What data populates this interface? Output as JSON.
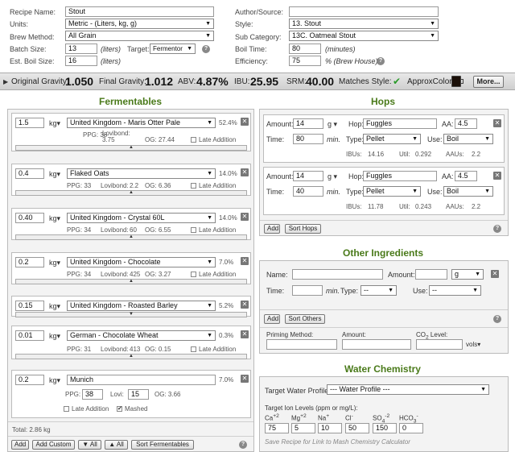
{
  "recipe": {
    "name_label": "Recipe Name:",
    "name_value": "Stout",
    "units_label": "Units:",
    "units_value": "Metric - (Liters, kg, g)",
    "method_label": "Brew Method:",
    "method_value": "All Grain",
    "batch_label": "Batch Size:",
    "batch_value": "13",
    "batch_unit": "(liters)",
    "target_label": "Target:",
    "target_value": "Fermentor",
    "boil_size_label": "Est. Boil Size:",
    "boil_size_value": "16",
    "boil_size_unit": "(liters)",
    "author_label": "Author/Source:",
    "author_value": "",
    "style_label": "Style:",
    "style_value": "13. Stout",
    "subcat_label": "Sub Category:",
    "subcat_value": "13C. Oatmeal Stout",
    "boil_time_label": "Boil Time:",
    "boil_time_value": "80",
    "boil_time_unit": "(minutes)",
    "eff_label": "Efficiency:",
    "eff_value": "75",
    "eff_unit": "% (Brew House)"
  },
  "stats": {
    "og_label": "Original Gravity:",
    "og_value": "1.050",
    "fg_label": "Final Gravity:",
    "fg_value": "1.012",
    "abv_label": "ABV:",
    "abv_value": "4.87%",
    "ibu_label": "IBU:",
    "ibu_value": "25.95",
    "srm_label": "SRM:",
    "srm_value": "40.00",
    "matches_label": "Matches Style:",
    "color_label": "ApproxColor:",
    "more_button": "More...",
    "check_icon": "✔"
  },
  "fermentables": {
    "title": "Fermentables",
    "kg_unit": "kg▾",
    "late_label": "Late Addition",
    "mashed_label": "Mashed",
    "items": [
      {
        "amount": "1.5",
        "name": "United Kingdom - Maris Otter Pale",
        "pct": "52.4%",
        "ppg": "PPG: 38",
        "lov_label": "Lovibond:",
        "lov": "3.75",
        "og": "OG: 27.44"
      },
      {
        "amount": "0.4",
        "name": "Flaked Oats",
        "pct": "14.0%",
        "ppg": "PPG: 33",
        "lov_label": "Lovibond:",
        "lov": "2.2",
        "og": "OG: 6.36"
      },
      {
        "amount": "0.40",
        "name": "United Kingdom - Crystal 60L",
        "pct": "14.0%",
        "ppg": "PPG: 34",
        "lov_label": "Lovibond:",
        "lov": "60",
        "og": "OG: 6.55"
      },
      {
        "amount": "0.2",
        "name": "United Kingdom - Chocolate",
        "pct": "7.0%",
        "ppg": "PPG: 34",
        "lov_label": "Lovibond:",
        "lov": "425",
        "og": "OG: 3.27"
      },
      {
        "amount": "0.15",
        "name": "United Kingdom - Roasted Barley",
        "pct": "5.2%",
        "ppg": "",
        "lov_label": "",
        "lov": "",
        "og": ""
      },
      {
        "amount": "0.01",
        "name": "German - Chocolate Wheat",
        "pct": "0.3%",
        "ppg": "PPG: 31",
        "lov_label": "Lovibond:",
        "lov": "413",
        "og": "OG: 0.15"
      }
    ],
    "custom": {
      "amount": "0.2",
      "name": "Munich",
      "pct": "7.0%",
      "ppg_label": "PPG:",
      "ppg": "38",
      "lovi_label": "Lovi:",
      "lovi": "15",
      "og": "OG: 3.66"
    },
    "total": "Total: 2.86 kg",
    "buttons": {
      "add": "Add",
      "add_custom": "Add Custom",
      "down_all": "▼ All",
      "up_all": "▲ All",
      "sort": "Sort Fermentables"
    }
  },
  "hops": {
    "title": "Hops",
    "amount_label": "Amount:",
    "g_unit": "g ▾",
    "hop_label": "Hop:",
    "aa_label": "AA:",
    "time_label": "Time:",
    "min_unit": "min.",
    "type_label": "Type:",
    "use_label": "Use:",
    "items": [
      {
        "amount": "14",
        "hop": "Fuggles",
        "aa": "4.5",
        "time": "80",
        "type": "Pellet",
        "use": "Boil",
        "ibus_label": "IBUs:",
        "ibus": "14.16",
        "util_label": "Util:",
        "util": "0.292",
        "aaus_label": "AAUs:",
        "aaus": "2.2"
      },
      {
        "amount": "14",
        "hop": "Fuggles",
        "aa": "4.5",
        "time": "40",
        "type": "Pellet",
        "use": "Boil",
        "ibus_label": "IBUs:",
        "ibus": "11.78",
        "util_label": "Util:",
        "util": "0.243",
        "aaus_label": "AAUs:",
        "aaus": "2.2"
      }
    ],
    "buttons": {
      "add": "Add",
      "sort": "Sort Hops"
    }
  },
  "other": {
    "title": "Other Ingredients",
    "name_label": "Name:",
    "amount_label": "Amount:",
    "unit_value": "g",
    "time_label": "Time:",
    "min_unit": "min.",
    "type_label": "Type:",
    "type_value": "--",
    "use_label": "Use:",
    "use_value": "--",
    "buttons": {
      "add": "Add",
      "sort": "Sort Others"
    },
    "priming_label": "Priming Method:",
    "prime_amount_label": "Amount:",
    "co2_label": "CO",
    "co2_sub": "2",
    "co2_tail": " Level:",
    "vols_unit": "vols▾"
  },
  "water": {
    "title": "Water Chemistry",
    "profile_label": "Target Water Profile:",
    "profile_value": "--- Water Profile ---",
    "ion_label": "Target Ion Levels (ppm or mg/L):",
    "ions": [
      {
        "name": "Ca",
        "sup": "+2",
        "value": "75"
      },
      {
        "name": "Mg",
        "sup": "+2",
        "value": "5"
      },
      {
        "name": "Na",
        "sup": "+",
        "value": "10"
      },
      {
        "name": "Cl",
        "sup": "-",
        "value": "50"
      },
      {
        "name": "SO",
        "sub": "4",
        "sup": "-2",
        "value": "150"
      },
      {
        "name": "HCO",
        "sub": "3",
        "sup": "-",
        "value": "0"
      }
    ],
    "save_note": "Save Recipe for Link to Mash Chemistry Calculator"
  },
  "help_glyph": "?",
  "close_glyph": "✕",
  "arrow_glyph": "▼",
  "expand_glyph": "▲"
}
